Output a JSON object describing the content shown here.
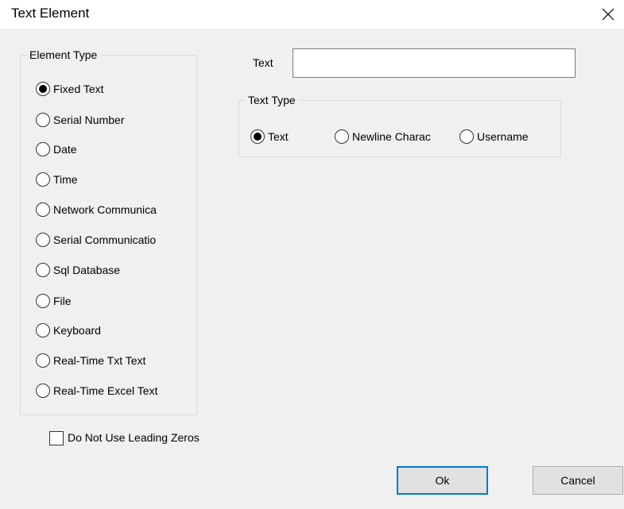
{
  "window": {
    "title": "Text Element"
  },
  "element_type": {
    "legend": "Element Type",
    "options": [
      {
        "label": "Fixed Text",
        "checked": true
      },
      {
        "label": "Serial Number",
        "checked": false
      },
      {
        "label": "Date",
        "checked": false
      },
      {
        "label": "Time",
        "checked": false
      },
      {
        "label": "Network Communica",
        "checked": false
      },
      {
        "label": "Serial Communicatio",
        "checked": false
      },
      {
        "label": "Sql Database",
        "checked": false
      },
      {
        "label": "File",
        "checked": false
      },
      {
        "label": "Keyboard",
        "checked": false
      },
      {
        "label": "Real-Time Txt Text",
        "checked": false
      },
      {
        "label": "Real-Time Excel Text",
        "checked": false
      }
    ]
  },
  "text_field": {
    "label": "Text",
    "value": ""
  },
  "text_type": {
    "legend": "Text Type",
    "options": [
      {
        "label": "Text",
        "checked": true
      },
      {
        "label": "Newline Charac",
        "checked": false
      },
      {
        "label": "Username",
        "checked": false
      }
    ]
  },
  "leading_zeros": {
    "label": "Do Not Use Leading Zeros",
    "checked": false
  },
  "buttons": {
    "ok": "Ok",
    "cancel": "Cancel"
  },
  "icons": {
    "close": "close-icon",
    "radio": "radio-icon"
  },
  "colors": {
    "accent": "#0078d7",
    "background": "#f0f0f0"
  }
}
